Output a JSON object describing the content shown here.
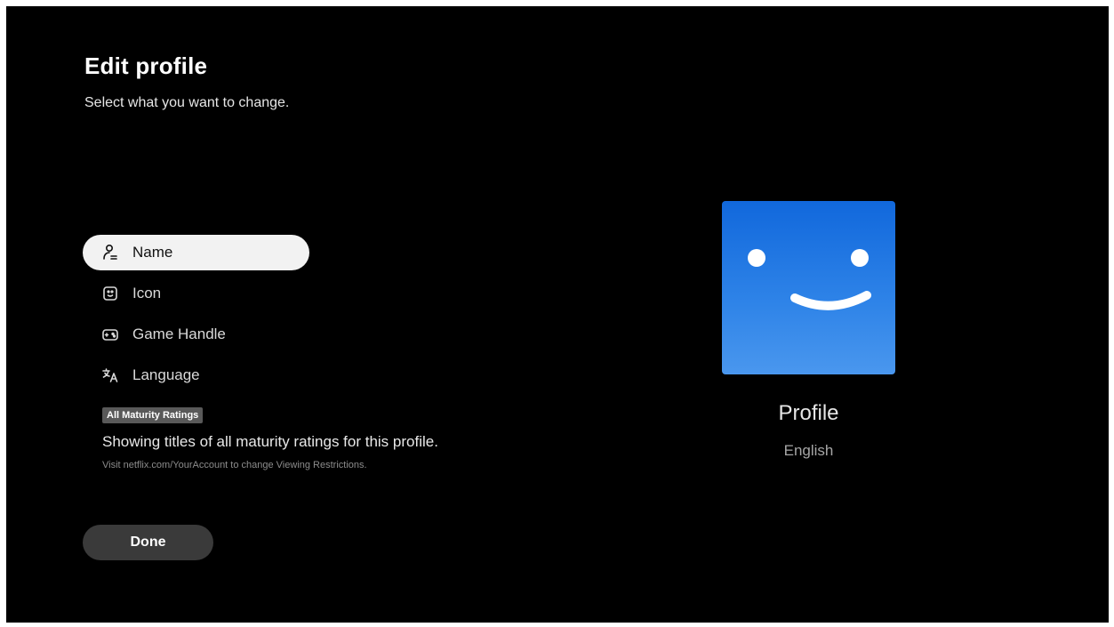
{
  "header": {
    "title": "Edit profile",
    "subtitle": "Select what you want to change."
  },
  "menu": {
    "items": [
      {
        "label": "Name",
        "icon": "person-edit-icon",
        "selected": true
      },
      {
        "label": "Icon",
        "icon": "profile-icon",
        "selected": false
      },
      {
        "label": "Game Handle",
        "icon": "gamepad-icon",
        "selected": false
      },
      {
        "label": "Language",
        "icon": "translate-icon",
        "selected": false
      }
    ]
  },
  "maturity": {
    "badge": "All Maturity Ratings",
    "description": "Showing titles of all maturity ratings for this profile.",
    "note": "Visit netflix.com/YourAccount to change Viewing Restrictions."
  },
  "actions": {
    "done_label": "Done"
  },
  "profile": {
    "name": "Profile",
    "language": "English",
    "avatar_icon": "smiley-face-icon",
    "avatar_color": "#1f74e0"
  },
  "colors": {
    "background": "#000000",
    "selected_item_bg": "#f2f2f2",
    "done_button_bg": "#3a3a3a",
    "badge_bg": "#595959"
  }
}
